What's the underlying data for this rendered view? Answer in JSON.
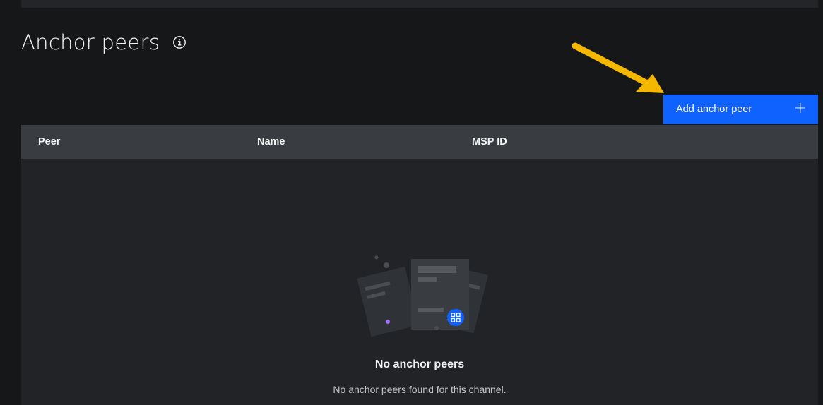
{
  "section": {
    "title": "Anchor peers",
    "info_icon": "information-icon"
  },
  "toolbar": {
    "add_label": "Add anchor peer",
    "add_icon": "plus-icon",
    "accent_color": "#0f62fe"
  },
  "annotation": {
    "arrow_icon": "arrow-icon",
    "arrow_color": "#f5b800"
  },
  "table": {
    "columns": [
      "Peer",
      "Name",
      "MSP ID"
    ]
  },
  "empty_state": {
    "icon": "empty-documents-illustration",
    "title": "No anchor peers",
    "description": "No anchor peers found for this channel."
  }
}
